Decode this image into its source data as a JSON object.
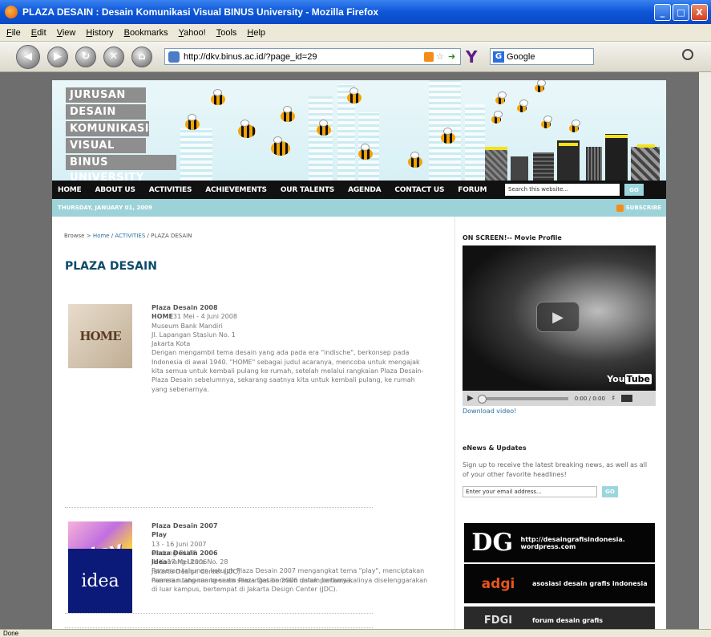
{
  "window": {
    "title": "PLAZA DESAIN : Desain Komunikasi Visual BINUS University - Mozilla Firefox",
    "controls": [
      "_",
      "□",
      "X"
    ]
  },
  "menu": [
    "File",
    "Edit",
    "View",
    "History",
    "Bookmarks",
    "Yahoo!",
    "Tools",
    "Help"
  ],
  "toolbar": {
    "url": "http://dkv.binus.ac.id/?page_id=29",
    "search_engine": "Google",
    "search_engine_glyph": "G"
  },
  "status": "Done",
  "header": {
    "logo_lines": [
      "JURUSAN",
      "DESAIN",
      "KOMUNIKASI",
      "VISUAL",
      "BINUS UNIVERSITY"
    ]
  },
  "nav": {
    "items": [
      "HOME",
      "ABOUT US",
      "ACTIVITIES",
      "ACHIEVEMENTS",
      "OUR TALENTS",
      "AGENDA",
      "CONTACT US",
      "FORUM"
    ],
    "search_value": "Search this website...",
    "search_go": "GO"
  },
  "datebar": {
    "date": "THURSDAY, JANUARY 01, 2009",
    "subscribe": "SUBSCRIBE"
  },
  "breadcrumb": {
    "prefix": "Browse >",
    "home": "Home",
    "sep1": "/",
    "section": "ACTIVITIES",
    "sep2": "/",
    "current": "PLAZA DESAIN"
  },
  "page_title": "PLAZA DESAIN",
  "entries": [
    {
      "thumb_text": "HOME",
      "title": "Plaza Desain 2008",
      "theme": "HOME",
      "date": "31 Mei - 4 Juni 2008",
      "venue": "Museum Bank Mandiri",
      "address": "Jl. Lapangan Stasiun No. 1",
      "city": "Jakarta Kota",
      "desc": "Dengan mengambil tema desain yang ada pada era \"indische\", berkonsep pada Indonesia di awal 1940. \"HOME\" sebagai judul acaranya, mencoba untuk mengajak kita semua untuk kembali pulang ke rumah, setelah melalui rangkaian Plaza Desain-Plaza Desain sebelumnya, sekarang saatnya kita untuk kembali pulang, ke rumah yang sebenarnya."
    },
    {
      "thumb_text": "play",
      "title": "Plaza Desain 2007",
      "theme": "Play",
      "date": "13 - 16 Juni 2007",
      "venue": "Gedung DUA8",
      "address": "Jl. Kemang Utara No. 28",
      "city": "",
      "desc": "Pameran tahunan ketujuh Plaza Desain 2007 mengangkat tema \"play\", menciptakan nuansa ruang-ruang serta semangat bermain dalam berkarya."
    },
    {
      "thumb_text": "idea",
      "title": "Plaza Desain 2006",
      "theme": "Idea",
      "date": "17 Mei 2006",
      "venue": "Jakarta Design Center (JDC)",
      "address": "",
      "city": "",
      "desc": "Pameran tahunan keenam Plaza Desain 2006 untuk pertama kalinya diselenggarakan di luar kampus, bertempat di Jakarta Design Center (JDC)."
    }
  ],
  "sidebar": {
    "video_heading": "ON SCREEN!-- Movie Profile",
    "video_time": "0:00 / 0:00",
    "youtube_you": "You",
    "youtube_tube": "Tube",
    "download": "Download video!",
    "enews_heading": "eNews & Updates",
    "enews_text": "Sign up to receive the latest breaking news, as well as all of your other favorite headlines!",
    "email_placeholder": "Enter your email address...",
    "email_go": "GO",
    "ads": [
      {
        "logo": "DG",
        "text": "http://desaingrafisindonesia. wordpress.com"
      },
      {
        "logo": "adgi",
        "text": "asosiasi desain grafis indonesia"
      },
      {
        "logo": "FDGI",
        "text": "forum desain grafis"
      }
    ]
  },
  "colors": {
    "nav_bg": "#111111",
    "datebar_bg": "#9dd3d8",
    "title": "#0d4a6a",
    "link": "#2a6fa0"
  }
}
